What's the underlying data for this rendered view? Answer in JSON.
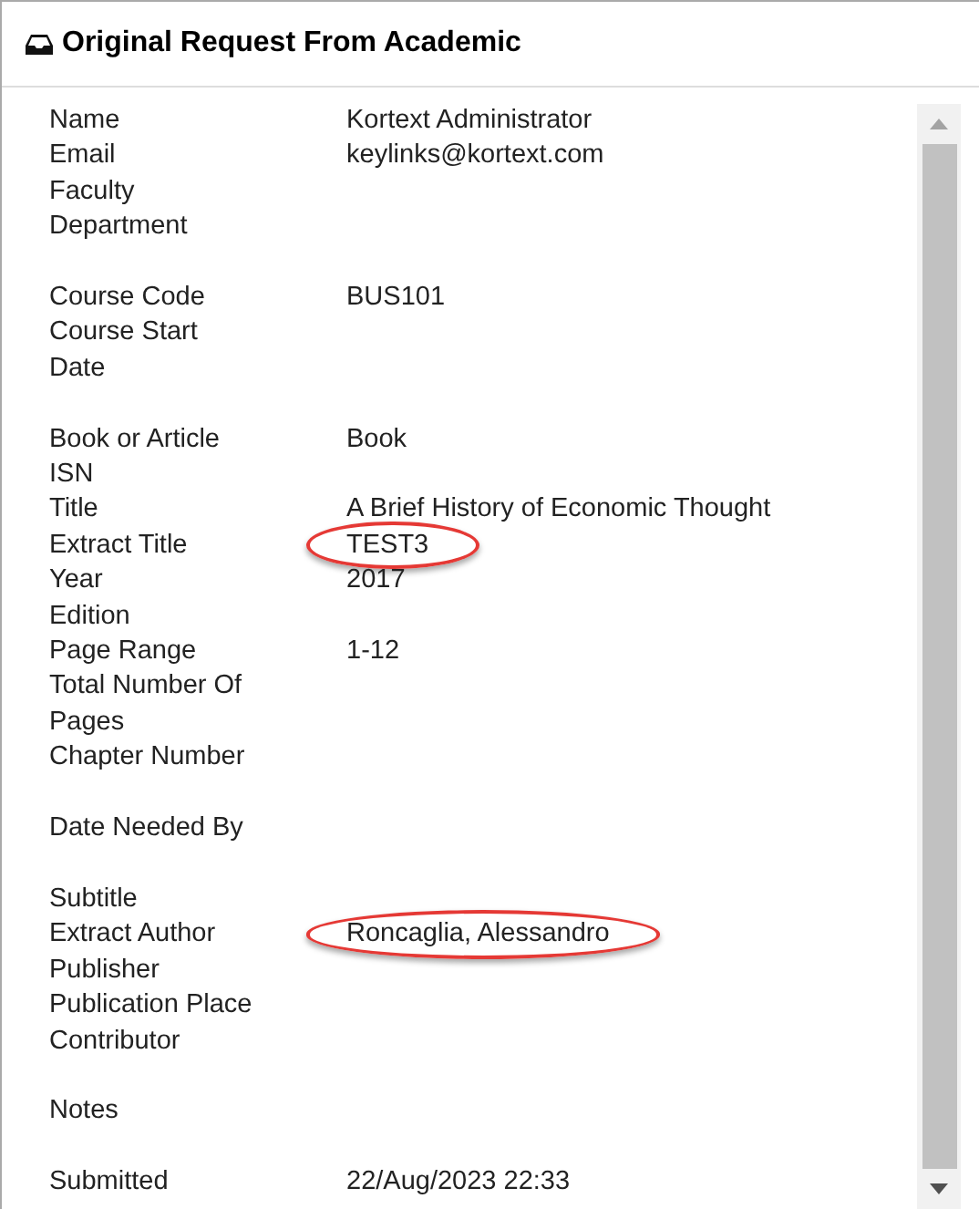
{
  "panel": {
    "title": "Original Request From Academic"
  },
  "fields": [
    {
      "label": "Name",
      "value": "Kortext Administrator",
      "circled": false,
      "gap_after": false
    },
    {
      "label": "Email",
      "value": "keylinks@kortext.com",
      "circled": false,
      "gap_after": false
    },
    {
      "label": "Faculty\nDepartment",
      "circled": false,
      "gap_after": true
    },
    {
      "label": "Course Code",
      "value": "BUS101",
      "circled": false,
      "gap_after": false
    },
    {
      "label": "Course Start\nDate",
      "circled": false,
      "gap_after": true
    },
    {
      "label": "Book or Article",
      "value": "Book",
      "circled": false,
      "gap_after": false
    },
    {
      "label": "ISN",
      "circled": false,
      "gap_after": false
    },
    {
      "label": "Title",
      "value": "A Brief History of Economic Thought",
      "circled": false,
      "gap_after": false
    },
    {
      "label": "Extract Title",
      "value": "TEST3",
      "circled": true,
      "gap_after": false
    },
    {
      "label": "Year",
      "value": "2017",
      "circled": false,
      "gap_after": false
    },
    {
      "label": "Edition",
      "circled": false,
      "gap_after": false
    },
    {
      "label": "Page Range",
      "value": "1-12",
      "circled": false,
      "gap_after": false
    },
    {
      "label": "Total Number Of\nPages",
      "circled": false,
      "gap_after": false
    },
    {
      "label": "Chapter Number",
      "circled": false,
      "gap_after": true
    },
    {
      "label": "Date Needed By",
      "circled": false,
      "gap_after": true
    },
    {
      "label": "Subtitle",
      "circled": false,
      "gap_after": false
    },
    {
      "label": "Extract Author",
      "value": "Roncaglia, Alessandro",
      "circled": true,
      "gap_after": false
    },
    {
      "label": "Publisher",
      "circled": false,
      "gap_after": false
    },
    {
      "label": "Publication Place",
      "circled": false,
      "gap_after": false
    },
    {
      "label": "Contributor",
      "circled": false,
      "gap_after": true
    },
    {
      "label": "Notes",
      "circled": false,
      "gap_after": true
    },
    {
      "label": "Submitted",
      "value": "22/Aug/2023 22:33",
      "circled": false,
      "gap_after": false
    }
  ]
}
